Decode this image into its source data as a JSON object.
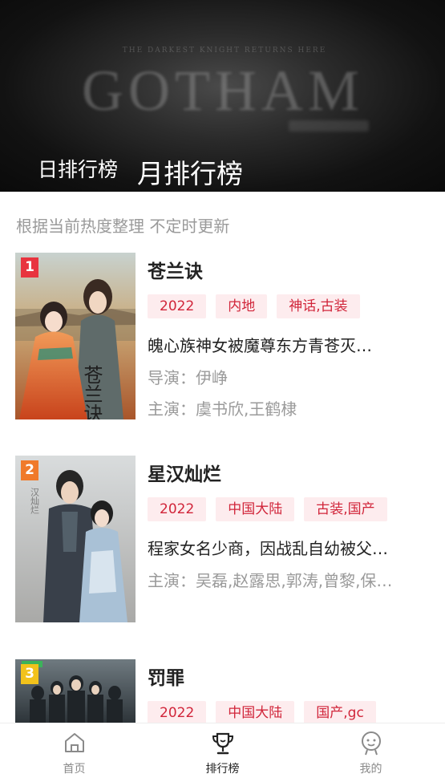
{
  "banner": {
    "small_text": "THE DARKEST KNIGHT RETURNS HERE",
    "background_word": "GOTHAM",
    "tabs": [
      {
        "label": "日排行榜",
        "active": false
      },
      {
        "label": "月排行榜",
        "active": true
      }
    ]
  },
  "subtitle": "根据当前热度整理 不定时更新",
  "items": [
    {
      "rank": "1",
      "rank_color": "#e8343f",
      "poster_art": "苍兰诀",
      "title": "苍兰诀",
      "tags": [
        "2022",
        "内地",
        "神话,古装"
      ],
      "desc": "魄心族神女被魔尊东方青苍灭…",
      "director": "导演：伊峥",
      "cast": "主演：虞书欣,王鹤棣"
    },
    {
      "rank": "2",
      "rank_color": "#f07a2b",
      "poster_art": "汉灿烂",
      "title": "星汉灿烂",
      "tags": [
        "2022",
        "中国大陆",
        "古装,国产"
      ],
      "desc": "程家女名少商，因战乱自幼被父…",
      "cast": "主演：吴磊,赵露思,郭涛,曾黎,保…"
    },
    {
      "rank": "3",
      "rank_color": "#f2c21b",
      "title": "罚罪",
      "tags": [
        "2022",
        "中国大陆",
        "国产,gc"
      ]
    }
  ],
  "nav": [
    {
      "label": "首页",
      "icon": "home-icon",
      "active": false
    },
    {
      "label": "排行榜",
      "icon": "trophy-icon",
      "active": true
    },
    {
      "label": "我的",
      "icon": "profile-icon",
      "active": false
    }
  ],
  "colors": {
    "tag_bg": "#fdecee",
    "tag_text": "#d1253a",
    "muted": "#9a9a9a"
  }
}
